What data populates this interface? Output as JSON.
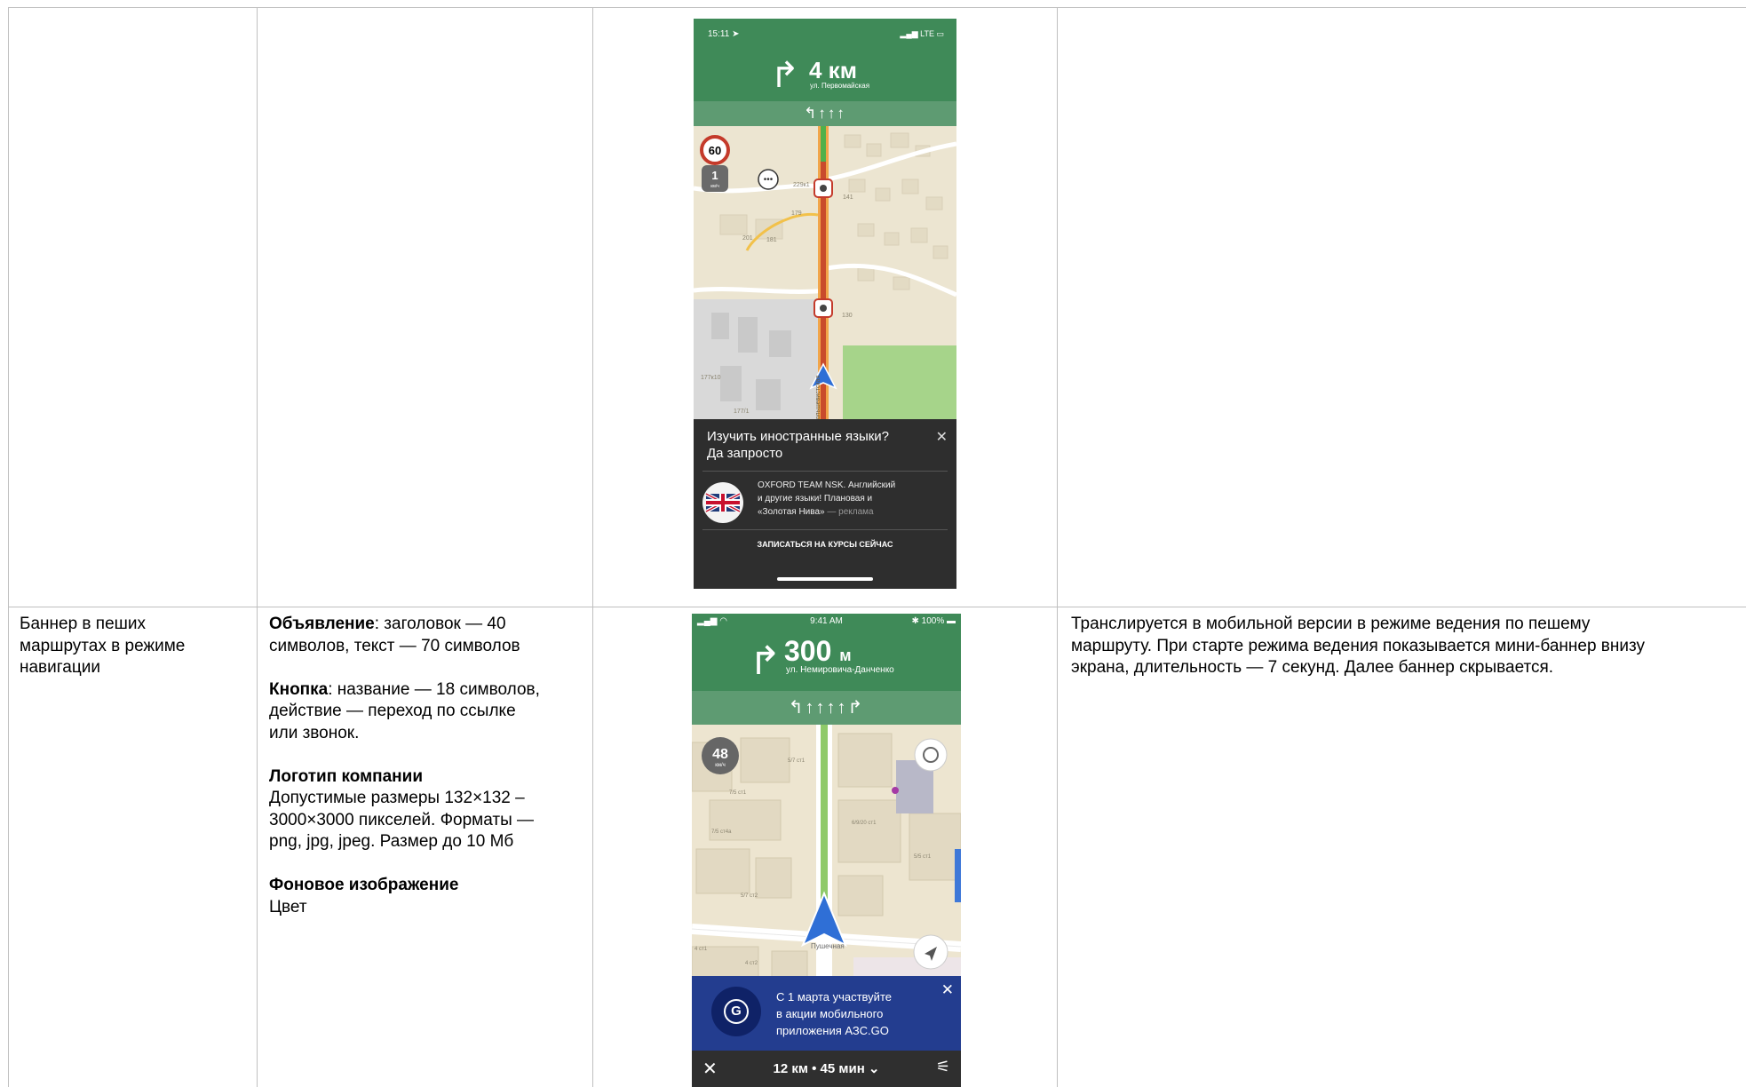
{
  "row2": {
    "col1": "Баннер в пеших\nмаршрутах в режиме\nнавигации",
    "col2": {
      "ad_bold": "Объявление",
      "ad_text": ": заголовок — 40\nсимволов, текст — 70 символов",
      "button_bold": "Кнопка",
      "button_text": ": название — 18 символов,\nдействие — переход по ссылке\nили звонок.",
      "logo_bold": "Логотип компании",
      "logo_text": "Допустимые размеры 132×132 –\n3000×3000 пикселей. Форматы —\npng, jpg, jpeg.  Размер до 10 Мб",
      "bg_bold": "Фоновое изображение",
      "bg_text": "Цвет"
    },
    "col4": "Транслируется в мобильной версии в режиме ведения по пешему\nмаршруту. При старте режима ведения показывается мини-баннер внизу\nэкрана, длительность — 7 секунд. Далее баннер скрывается."
  },
  "phone1": {
    "time": "15:11",
    "status_right": "LTE",
    "arrow_icon": "turn-right-arrow",
    "distance": "4 км",
    "street": "ул. Первомайская",
    "lanes": "↰↑↑↑",
    "speed_limit": "60",
    "speed_current": "1",
    "speed_unit": "км/ч",
    "map_labels": [
      "177к10",
      "177/1",
      "Большевистская",
      "130",
      "141",
      "179",
      "181",
      "229к1",
      "201"
    ],
    "banner": {
      "title": "Изучить иностранные языки?\nДа запросто",
      "text": "OXFORD TEAM NSK. Английский\nи другие языки! Плановая и\n«Золотая Нива»",
      "ad_mark": " — реклама",
      "cta": "ЗАПИСАТЬСЯ НА КУРСЫ СЕЙЧАС",
      "close": "✕"
    }
  },
  "phone2": {
    "time": "9:41 AM",
    "battery": "100%",
    "distance": "300",
    "distance_unit": "м",
    "street": "ул. Немировича-Данченко",
    "lanes": "↰↑↑↑↑↱",
    "speed": "48",
    "speed_unit": "км/ч",
    "map_labels": [
      "5/7 ст1",
      "7/5 ст1",
      "7/5 ст4а",
      "6/9/20 ст1",
      "5/5 ст1",
      "5/7 ст2",
      "4 ст1",
      "4 ст2",
      "Пушечная"
    ],
    "banner": {
      "text": "С 1 марта участвуйте\nв акции мобильного\nприложения АЗС.GO",
      "logo_letter": "G",
      "close": "✕"
    },
    "route": "12 км • 45 мин ⌄",
    "close": "✕",
    "options": "⚟"
  }
}
